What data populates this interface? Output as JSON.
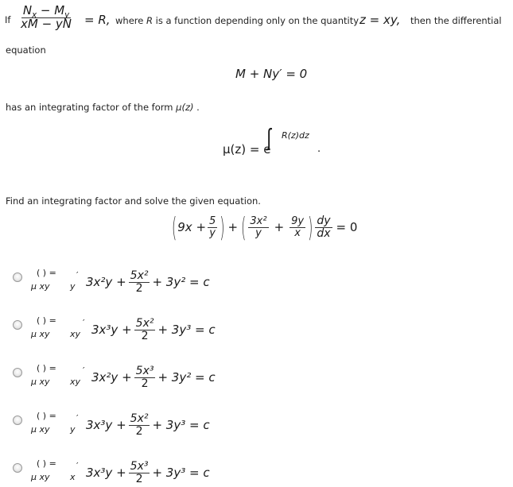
{
  "intro": {
    "if_label": "If",
    "fraction_numerator": "Nₓ − Mᵧ",
    "numer_N": "N",
    "numer_x": "x",
    "numer_minus": " − ",
    "numer_M": "M",
    "numer_y": "y",
    "denom": "xM − yN",
    "equals_R": "= R,",
    "text_middle": "where R is a function depending only on the quantity",
    "where": "where",
    "R": "R",
    "rest": "is a function depending only on the quantity",
    "z_eq": "z = xy,",
    "text_end": "then the differential",
    "line2": "equation"
  },
  "equation1": "M + Ny′ = 0",
  "integrating_factor_text": {
    "prefix": "has an integrating factor of the form",
    "mu": "μ(z)",
    "suffix": "."
  },
  "mu_formula": {
    "lhs": "μ(z) = e",
    "integral": "∫",
    "exponent": "R(z)dz",
    "period": "."
  },
  "prompt": "Find an integrating factor and solve the given equation.",
  "given_equation": {
    "term1_a": "9x +",
    "term1_num": "5",
    "term1_den": "y",
    "plus": "+",
    "term2_num": "3x²",
    "term2_den": "y",
    "term2_plus": "+",
    "term3_num": "9y",
    "term3_den": "x",
    "dy": "dy",
    "dx": "dx",
    "equals": "= 0"
  },
  "options": [
    {
      "mu_top": "(    ) =",
      "mu_bottom": "μ xy",
      "factor": "y",
      "tick": "′",
      "t1": "3x²y +",
      "frac_num": "5x²",
      "frac_den": "2",
      "t2": "+ 3y² = c",
      "selected": false
    },
    {
      "mu_top": "(    ) =",
      "mu_bottom": "μ xy",
      "factor": "xy",
      "tick": "′",
      "t1": "3x³y +",
      "frac_num": "5x²",
      "frac_den": "2",
      "t2": "+ 3y³ = c",
      "selected": false
    },
    {
      "mu_top": "(    ) =",
      "mu_bottom": "μ xy",
      "factor": "xy",
      "tick": "′",
      "t1": "3x²y +",
      "frac_num": "5x³",
      "frac_den": "2",
      "t2": "+ 3y² = c",
      "selected": false
    },
    {
      "mu_top": "(    ) =",
      "mu_bottom": "μ xy",
      "factor": "y",
      "tick": "′",
      "t1": "3x³y +",
      "frac_num": "5x²",
      "frac_den": "2",
      "t2": "+ 3y³ = c",
      "selected": false
    },
    {
      "mu_top": "(    ) =",
      "mu_bottom": "μ xy",
      "factor": "x",
      "tick": "′",
      "t1": "3x³y +",
      "frac_num": "5x³",
      "frac_den": "2",
      "t2": "+ 3y³ = c",
      "selected": false
    }
  ]
}
